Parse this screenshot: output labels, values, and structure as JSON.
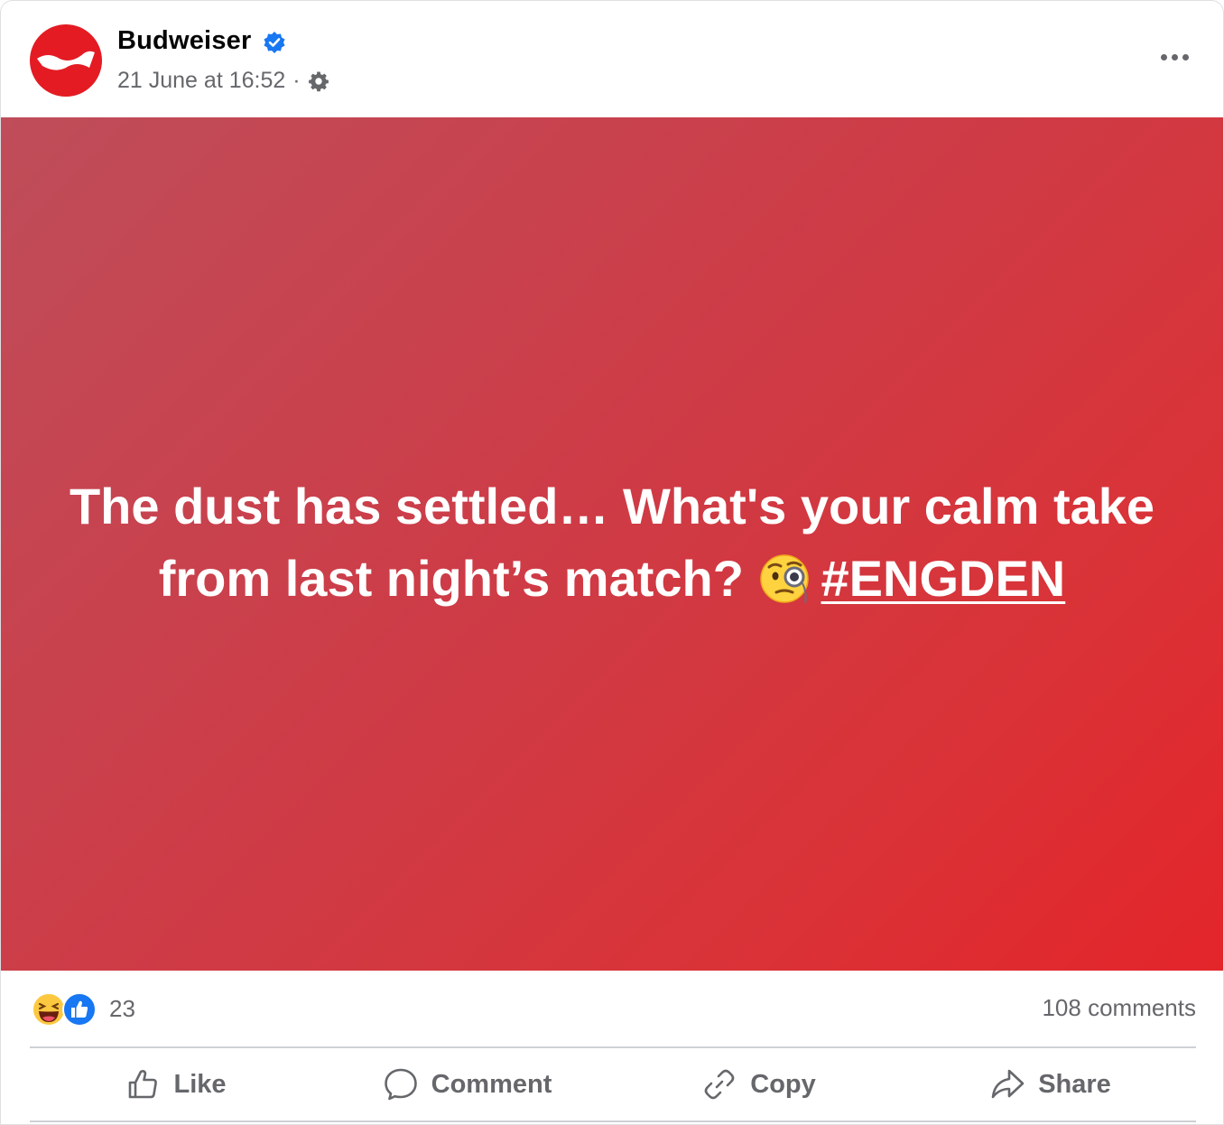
{
  "post": {
    "page_name": "Budweiser",
    "timestamp": "21 June at 16:52",
    "separator": "·",
    "text_main": "The dust has settled… What's your calm take from last night’s match?",
    "hashtag": "#ENGDEN",
    "emoji": "monocle-face",
    "background_colors": [
      "#bf4d5a",
      "#e3252a"
    ]
  },
  "stats": {
    "reaction_icons": [
      "haha",
      "like"
    ],
    "reaction_count": "23",
    "comments": "108 comments"
  },
  "actions": {
    "like": "Like",
    "comment": "Comment",
    "copy": "Copy",
    "share": "Share"
  },
  "colors": {
    "brand_red": "#e41b23",
    "verified_blue": "#1877f2",
    "secondary_text": "#65676b"
  }
}
